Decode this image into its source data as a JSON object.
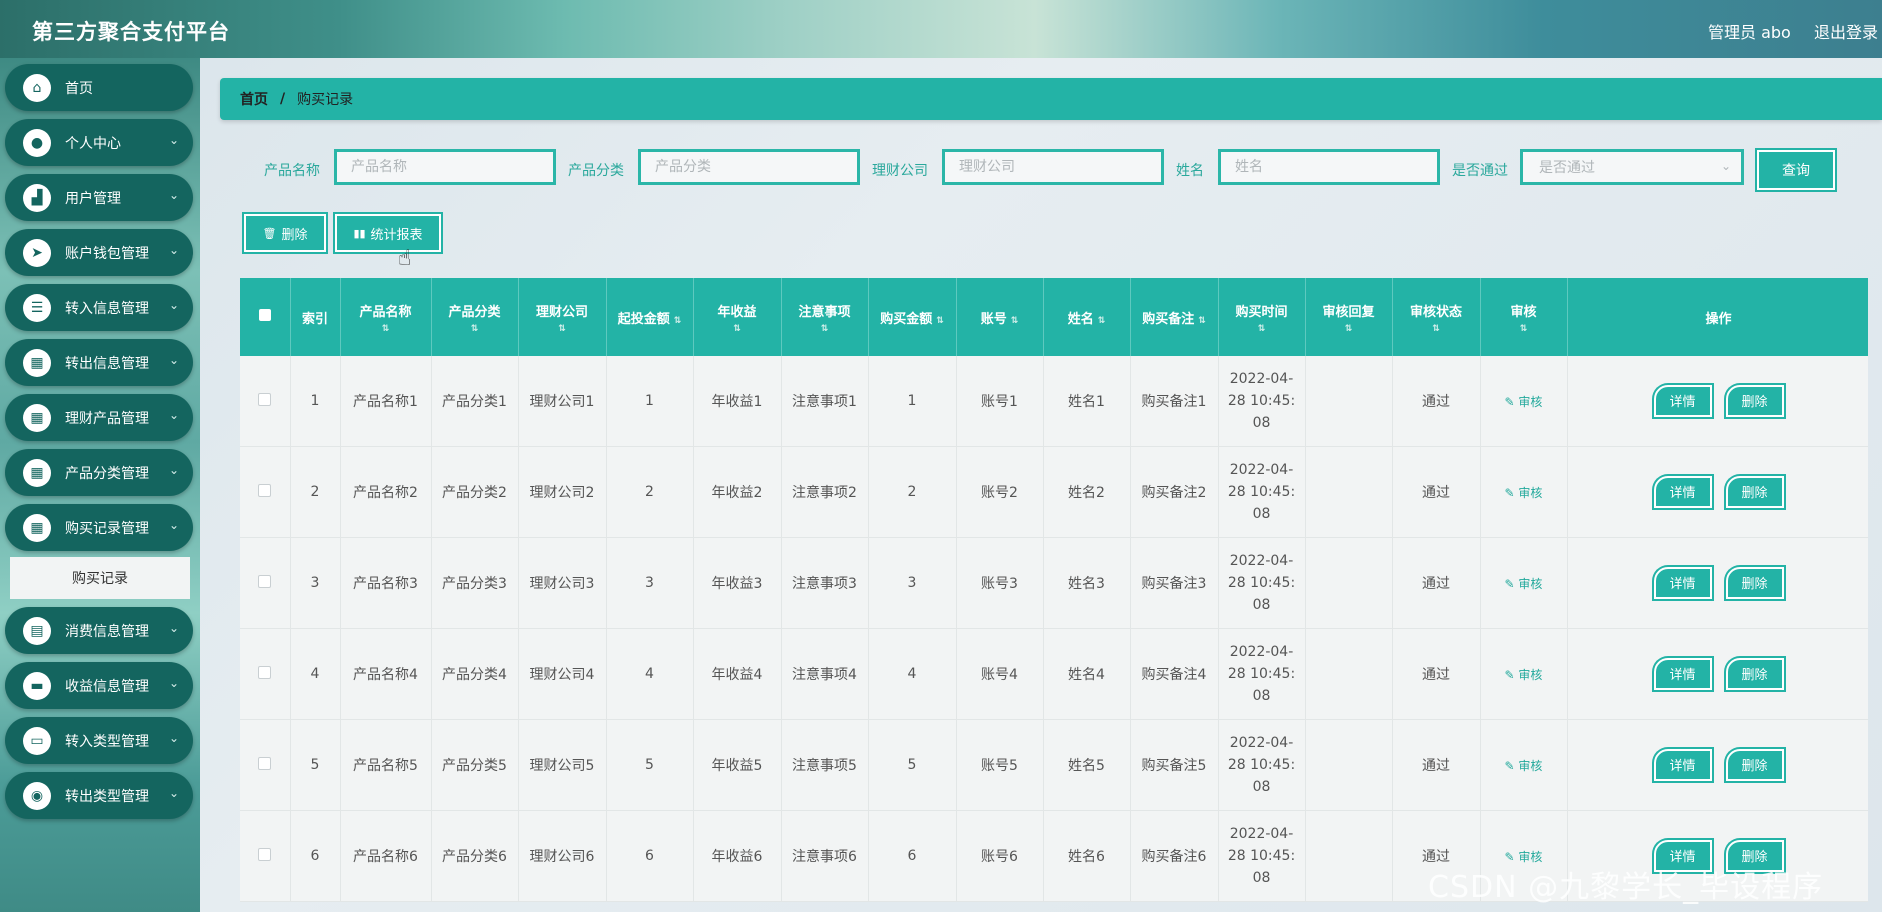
{
  "header": {
    "title": "第三方聚合支付平台",
    "user": "管理员 abo",
    "logout": "退出登录"
  },
  "sidebar": {
    "items": [
      {
        "label": "首页",
        "icon": "home-icon",
        "caret": false
      },
      {
        "label": "个人中心",
        "icon": "user-icon",
        "caret": true
      },
      {
        "label": "用户管理",
        "icon": "chart-icon",
        "caret": true
      },
      {
        "label": "账户钱包管理",
        "icon": "send-icon",
        "caret": true
      },
      {
        "label": "转入信息管理",
        "icon": "list-icon",
        "caret": true
      },
      {
        "label": "转出信息管理",
        "icon": "grid-icon",
        "caret": true
      },
      {
        "label": "理财产品管理",
        "icon": "grid-icon",
        "caret": true
      },
      {
        "label": "产品分类管理",
        "icon": "grid-icon",
        "caret": true
      },
      {
        "label": "购买记录管理",
        "icon": "grid-icon",
        "caret": true
      },
      {
        "label": "消费信息管理",
        "icon": "clipboard-icon",
        "caret": true
      },
      {
        "label": "收益信息管理",
        "icon": "wallet-icon",
        "caret": true
      },
      {
        "label": "转入类型管理",
        "icon": "monitor-icon",
        "caret": true
      },
      {
        "label": "转出类型管理",
        "icon": "person-icon",
        "caret": true
      }
    ],
    "active_sub": "购买记录"
  },
  "breadcrumb": {
    "home": "首页",
    "separator": "/",
    "current": "购买记录"
  },
  "search": {
    "fields": [
      {
        "label": "产品名称",
        "placeholder": "产品名称"
      },
      {
        "label": "产品分类",
        "placeholder": "产品分类"
      },
      {
        "label": "理财公司",
        "placeholder": "理财公司"
      },
      {
        "label": "姓名",
        "placeholder": "姓名"
      }
    ],
    "select_label": "是否通过",
    "select_placeholder": "是否通过",
    "query_button": "查询"
  },
  "actions": {
    "delete": "删除",
    "report": "统计报表"
  },
  "table": {
    "headers": [
      "索引",
      "产品名称",
      "产品分类",
      "理财公司",
      "起投金额",
      "年收益",
      "注意事项",
      "购买金额",
      "账号",
      "姓名",
      "购买备注",
      "购买时间",
      "审核回复",
      "审核状态",
      "审核",
      "操作"
    ],
    "rows": [
      {
        "idx": "1",
        "name": "产品名称1",
        "cat": "产品分类1",
        "co": "理财公司1",
        "min": "1",
        "yield": "年收益1",
        "note": "注意事项1",
        "amt": "1",
        "acct": "账号1",
        "pname": "姓名1",
        "remark": "购买备注1",
        "t1": "2022-04-",
        "t2": "28 10:45:",
        "t3": "08",
        "reply": "",
        "status": "通过",
        "audit": "审核"
      },
      {
        "idx": "2",
        "name": "产品名称2",
        "cat": "产品分类2",
        "co": "理财公司2",
        "min": "2",
        "yield": "年收益2",
        "note": "注意事项2",
        "amt": "2",
        "acct": "账号2",
        "pname": "姓名2",
        "remark": "购买备注2",
        "t1": "2022-04-",
        "t2": "28 10:45:",
        "t3": "08",
        "reply": "",
        "status": "通过",
        "audit": "审核"
      },
      {
        "idx": "3",
        "name": "产品名称3",
        "cat": "产品分类3",
        "co": "理财公司3",
        "min": "3",
        "yield": "年收益3",
        "note": "注意事项3",
        "amt": "3",
        "acct": "账号3",
        "pname": "姓名3",
        "remark": "购买备注3",
        "t1": "2022-04-",
        "t2": "28 10:45:",
        "t3": "08",
        "reply": "",
        "status": "通过",
        "audit": "审核"
      },
      {
        "idx": "4",
        "name": "产品名称4",
        "cat": "产品分类4",
        "co": "理财公司4",
        "min": "4",
        "yield": "年收益4",
        "note": "注意事项4",
        "amt": "4",
        "acct": "账号4",
        "pname": "姓名4",
        "remark": "购买备注4",
        "t1": "2022-04-",
        "t2": "28 10:45:",
        "t3": "08",
        "reply": "",
        "status": "通过",
        "audit": "审核"
      },
      {
        "idx": "5",
        "name": "产品名称5",
        "cat": "产品分类5",
        "co": "理财公司5",
        "min": "5",
        "yield": "年收益5",
        "note": "注意事项5",
        "amt": "5",
        "acct": "账号5",
        "pname": "姓名5",
        "remark": "购买备注5",
        "t1": "2022-04-",
        "t2": "28 10:45:",
        "t3": "08",
        "reply": "",
        "status": "通过",
        "audit": "审核"
      },
      {
        "idx": "6",
        "name": "产品名称6",
        "cat": "产品分类6",
        "co": "理财公司6",
        "min": "6",
        "yield": "年收益6",
        "note": "注意事项6",
        "amt": "6",
        "acct": "账号6",
        "pname": "姓名6",
        "remark": "购买备注6",
        "t1": "2022-04-",
        "t2": "28 10:45:",
        "t3": "08",
        "reply": "",
        "status": "通过",
        "audit": "审核"
      }
    ],
    "row_buttons": {
      "detail": "详情",
      "delete": "删除"
    }
  },
  "watermark": "CSDN @九黎学长_毕设程序",
  "colors": {
    "accent": "#23b3a6",
    "sidebar_item": "#14655f"
  }
}
